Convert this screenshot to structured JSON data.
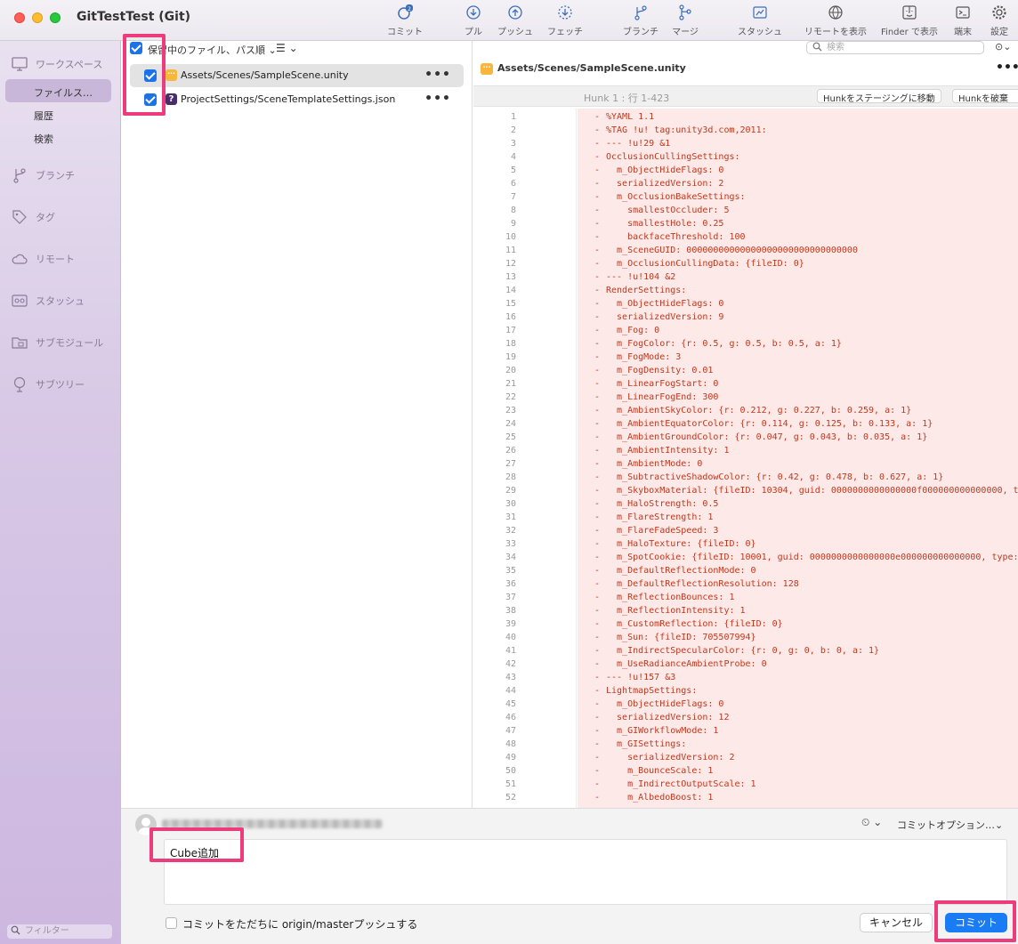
{
  "window": {
    "title": "GitTestTest (Git)"
  },
  "toolbar": {
    "commit_badge": "2",
    "items": [
      {
        "label": "コミット"
      },
      {
        "label": "プル"
      },
      {
        "label": "プッシュ"
      },
      {
        "label": "フェッチ"
      },
      {
        "label": "ブランチ"
      },
      {
        "label": "マージ"
      },
      {
        "label": "スタッシュ"
      },
      {
        "label": "リモートを表示"
      },
      {
        "label": "Finder で表示"
      },
      {
        "label": "端末"
      },
      {
        "label": "設定"
      }
    ]
  },
  "sidebar": {
    "workspace_label": "ワークスペース",
    "workspace_items": [
      {
        "label": "ファイルス…"
      },
      {
        "label": "履歴"
      },
      {
        "label": "検索"
      }
    ],
    "sections": [
      {
        "label": "ブランチ",
        "icon": "branch-icon"
      },
      {
        "label": "タグ",
        "icon": "tag-icon"
      },
      {
        "label": "リモート",
        "icon": "cloud-icon"
      },
      {
        "label": "スタッシュ",
        "icon": "stash-icon"
      },
      {
        "label": "サブモジュール",
        "icon": "folder-icon"
      },
      {
        "label": "サブツリー",
        "icon": "tree-icon"
      }
    ],
    "filter_placeholder": "フィルター"
  },
  "file_list": {
    "header": "保留中のファイル、パス順",
    "files": [
      {
        "name": "Assets/Scenes/SampleScene.unity",
        "status": "modified",
        "checked": true
      },
      {
        "name": "ProjectSettings/SceneTemplateSettings.json",
        "status": "untracked",
        "checked": true
      }
    ]
  },
  "diff": {
    "search_placeholder": "検索",
    "file_title": "Assets/Scenes/SampleScene.unity",
    "hunk_label": "Hunk 1 : 行 1-423",
    "stage_hunk_label": "Hunkをステージングに移動",
    "discard_hunk_label": "Hunkを破棄",
    "lines": [
      "%YAML 1.1",
      "%TAG !u! tag:unity3d.com,2011:",
      "--- !u!29 &1",
      "OcclusionCullingSettings:",
      "  m_ObjectHideFlags: 0",
      "  serializedVersion: 2",
      "  m_OcclusionBakeSettings:",
      "    smallestOccluder: 5",
      "    smallestHole: 0.25",
      "    backfaceThreshold: 100",
      "  m_SceneGUID: 00000000000000000000000000000000",
      "  m_OcclusionCullingData: {fileID: 0}",
      "--- !u!104 &2",
      "RenderSettings:",
      "  m_ObjectHideFlags: 0",
      "  serializedVersion: 9",
      "  m_Fog: 0",
      "  m_FogColor: {r: 0.5, g: 0.5, b: 0.5, a: 1}",
      "  m_FogMode: 3",
      "  m_FogDensity: 0.01",
      "  m_LinearFogStart: 0",
      "  m_LinearFogEnd: 300",
      "  m_AmbientSkyColor: {r: 0.212, g: 0.227, b: 0.259, a: 1}",
      "  m_AmbientEquatorColor: {r: 0.114, g: 0.125, b: 0.133, a: 1}",
      "  m_AmbientGroundColor: {r: 0.047, g: 0.043, b: 0.035, a: 1}",
      "  m_AmbientIntensity: 1",
      "  m_AmbientMode: 0",
      "  m_SubtractiveShadowColor: {r: 0.42, g: 0.478, b: 0.627, a: 1}",
      "  m_SkyboxMaterial: {fileID: 10304, guid: 0000000000000000f000000000000000, t",
      "  m_HaloStrength: 0.5",
      "  m_FlareStrength: 1",
      "  m_FlareFadeSpeed: 3",
      "  m_HaloTexture: {fileID: 0}",
      "  m_SpotCookie: {fileID: 10001, guid: 0000000000000000e000000000000000, type:",
      "  m_DefaultReflectionMode: 0",
      "  m_DefaultReflectionResolution: 128",
      "  m_ReflectionBounces: 1",
      "  m_ReflectionIntensity: 1",
      "  m_CustomReflection: {fileID: 0}",
      "  m_Sun: {fileID: 705507994}",
      "  m_IndirectSpecularColor: {r: 0, g: 0, b: 0, a: 1}",
      "  m_UseRadianceAmbientProbe: 0",
      "--- !u!157 &3",
      "LightmapSettings:",
      "  m_ObjectHideFlags: 0",
      "  serializedVersion: 12",
      "  m_GIWorkflowMode: 1",
      "  m_GISettings:",
      "    serializedVersion: 2",
      "    m_BounceScale: 1",
      "    m_IndirectOutputScale: 1",
      "    m_AlbedoBoost: 1"
    ]
  },
  "commit": {
    "options_label": "コミットオプション…",
    "message": "Cube追加",
    "push_label": "コミットをただちに origin/masterプッシュする",
    "cancel_label": "キャンセル",
    "commit_label": "コミット"
  },
  "colors": {
    "highlight": "#ec3c7c",
    "primary_button": "#1a7cf4",
    "removed_line_bg": "#fde9e7",
    "removed_line_text": "#c0381f"
  }
}
